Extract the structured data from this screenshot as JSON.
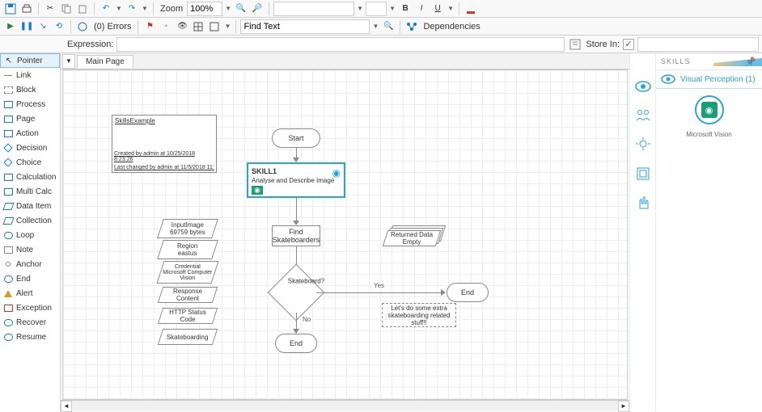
{
  "toolbar1": {
    "zoom_label": "Zoom",
    "zoom_value": "100%",
    "bold": "B",
    "italic": "I",
    "underline": "U"
  },
  "toolbar2": {
    "errors": "(0) Errors",
    "find_placeholder": "Find Text",
    "dependencies": "Dependencies"
  },
  "expr": {
    "label": "Expression:",
    "store_in": "Store In:"
  },
  "palette": [
    "Pointer",
    "Link",
    "Block",
    "Process",
    "Page",
    "Action",
    "Decision",
    "Choice",
    "Calculation",
    "Multi Calc",
    "Data Item",
    "Collection",
    "Loop",
    "Note",
    "Anchor",
    "End",
    "Alert",
    "Exception",
    "Recover",
    "Resume"
  ],
  "tab": {
    "main": "Main Page"
  },
  "note": {
    "title": "SkillsExample",
    "created": "Created by admin at 10/25/2018 8:23:26",
    "changed": "Last changed by admin at 11/5/2018 11:"
  },
  "flow": {
    "start": "Start",
    "skill_name": "SKILL1",
    "skill_desc": "Analyse and Describe Image",
    "find": "Find Skateboarders",
    "decision": "Skateboard?",
    "yes": "Yes",
    "no": "No",
    "end1": "End",
    "end2": "End",
    "returned": "Returned Data Empty",
    "extra": "Let's do some extra skateboarding related stuff!!"
  },
  "data_items": {
    "d1a": "InputImage",
    "d1b": "69759 bytes",
    "d2a": "Region",
    "d2b": "eastus",
    "d3a": "Credential",
    "d3b": "Microsoft Computer Vision",
    "d4": "Response Content",
    "d5": "HTTP Status Code",
    "d6": "Skateboarding"
  },
  "skills_panel": {
    "header": "SKILLS",
    "vp_label": "Visual Perception (1)",
    "tile_caption": "Microsoft Vision"
  }
}
